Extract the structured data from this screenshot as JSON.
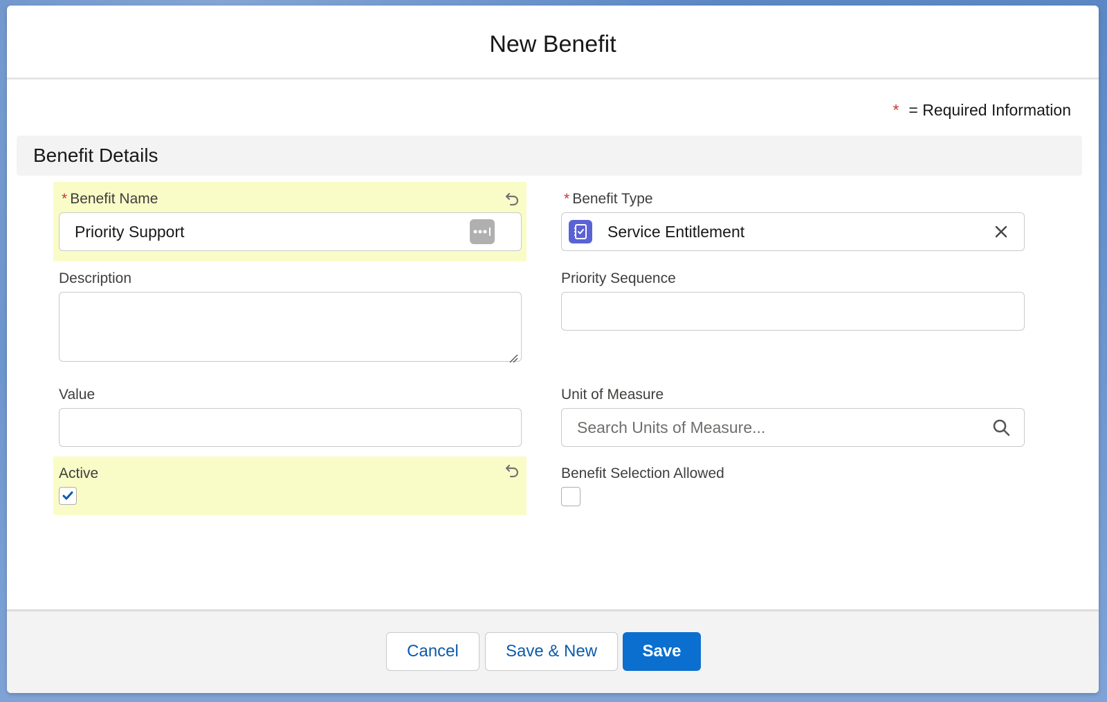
{
  "modal": {
    "title": "New Benefit",
    "required_legend": {
      "star": "*",
      "text": "= Required Information"
    }
  },
  "section": {
    "title": "Benefit Details"
  },
  "fields": {
    "benefit_name": {
      "required_star": "*",
      "label": "Benefit Name",
      "value": "Priority Support"
    },
    "benefit_type": {
      "required_star": "*",
      "label": "Benefit Type",
      "value": "Service Entitlement",
      "icon": "service-entitlement-icon"
    },
    "description": {
      "label": "Description",
      "value": ""
    },
    "priority_sequence": {
      "label": "Priority Sequence",
      "value": ""
    },
    "value": {
      "label": "Value",
      "value": ""
    },
    "unit_of_measure": {
      "label": "Unit of Measure",
      "placeholder": "Search Units of Measure...",
      "value": ""
    },
    "active": {
      "label": "Active",
      "checked": true
    },
    "benefit_selection_allowed": {
      "label": "Benefit Selection Allowed",
      "checked": false
    }
  },
  "footer": {
    "cancel_label": "Cancel",
    "save_new_label": "Save & New",
    "save_label": "Save"
  },
  "colors": {
    "required": "#c23934",
    "changed_highlight": "#fafcc8",
    "brand_button": "#0b6fd0",
    "link_text": "#0b5cab"
  }
}
